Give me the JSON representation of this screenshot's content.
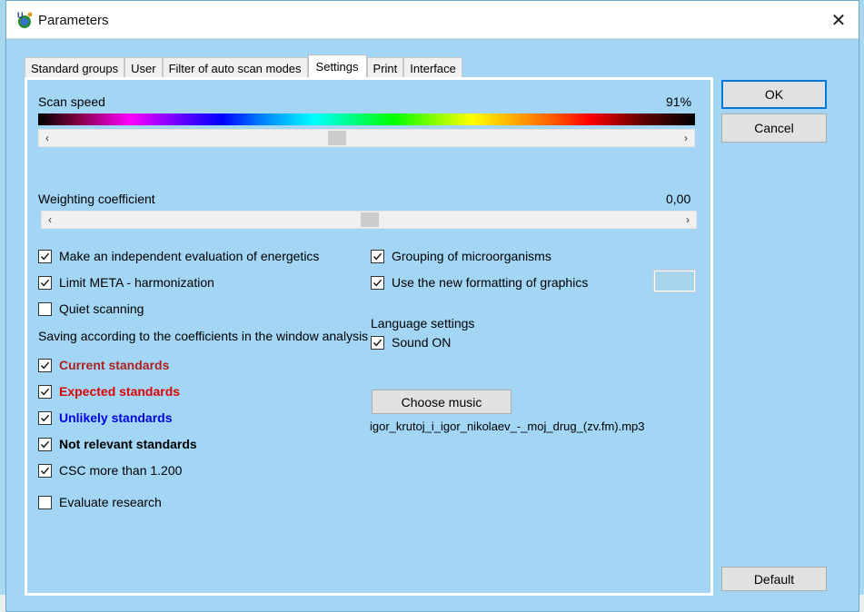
{
  "window": {
    "title": "Parameters",
    "close_glyph": "✕"
  },
  "tabs": [
    {
      "label": "Standard groups",
      "active": false
    },
    {
      "label": "User",
      "active": false
    },
    {
      "label": "Filter of auto scan modes",
      "active": false
    },
    {
      "label": "Settings",
      "active": true
    },
    {
      "label": "Print",
      "active": false
    },
    {
      "label": "Interface",
      "active": false
    }
  ],
  "scan_speed": {
    "label": "Scan speed",
    "value_text": "91%",
    "slider_level_percent": 45,
    "left_arrow": "‹",
    "right_arrow": "›"
  },
  "weighting": {
    "label": "Weighting coefficient",
    "value_text": "0,00",
    "slider_level_percent": 50,
    "left_arrow": "‹",
    "right_arrow": "›"
  },
  "left_options": {
    "independent_eval": {
      "label": "Make an independent evaluation of energetics",
      "checked": true
    },
    "limit_meta": {
      "label": "Limit META - harmonization",
      "checked": true
    },
    "quiet_scanning": {
      "label": "Quiet scanning",
      "checked": false
    },
    "saving_heading": "Saving according to the coefficients in the window analysis",
    "current_standards": {
      "label": "Current standards",
      "checked": true,
      "color": "#b02020"
    },
    "expected_standards": {
      "label": "Expected standards",
      "checked": true,
      "color": "#e00000"
    },
    "unlikely_standards": {
      "label": "Unlikely standards",
      "checked": true,
      "color": "#0000e0"
    },
    "not_relevant_standards": {
      "label": "Not relevant standards",
      "checked": true,
      "color": "#000000"
    },
    "csc": {
      "label": "CSC more than 1.200",
      "checked": true
    },
    "evaluate_research": {
      "label": "Evaluate research",
      "checked": false
    }
  },
  "right_options": {
    "grouping": {
      "label": "Grouping of microorganisms",
      "checked": true
    },
    "new_formatting": {
      "label": "Use the new formatting of graphics",
      "checked": true
    },
    "language_heading": "Language settings",
    "sound_on": {
      "label": "Sound ON",
      "checked": true
    },
    "choose_music_label": "Choose music",
    "music_file": "igor_krutoj_i_igor_nikolaev_-_moj_drug_(zv.fm).mp3"
  },
  "buttons": {
    "ok": "OK",
    "cancel": "Cancel",
    "default": "Default"
  },
  "colors": {
    "window_bg": "#a2d6f4",
    "focus_border": "#0078d7"
  }
}
